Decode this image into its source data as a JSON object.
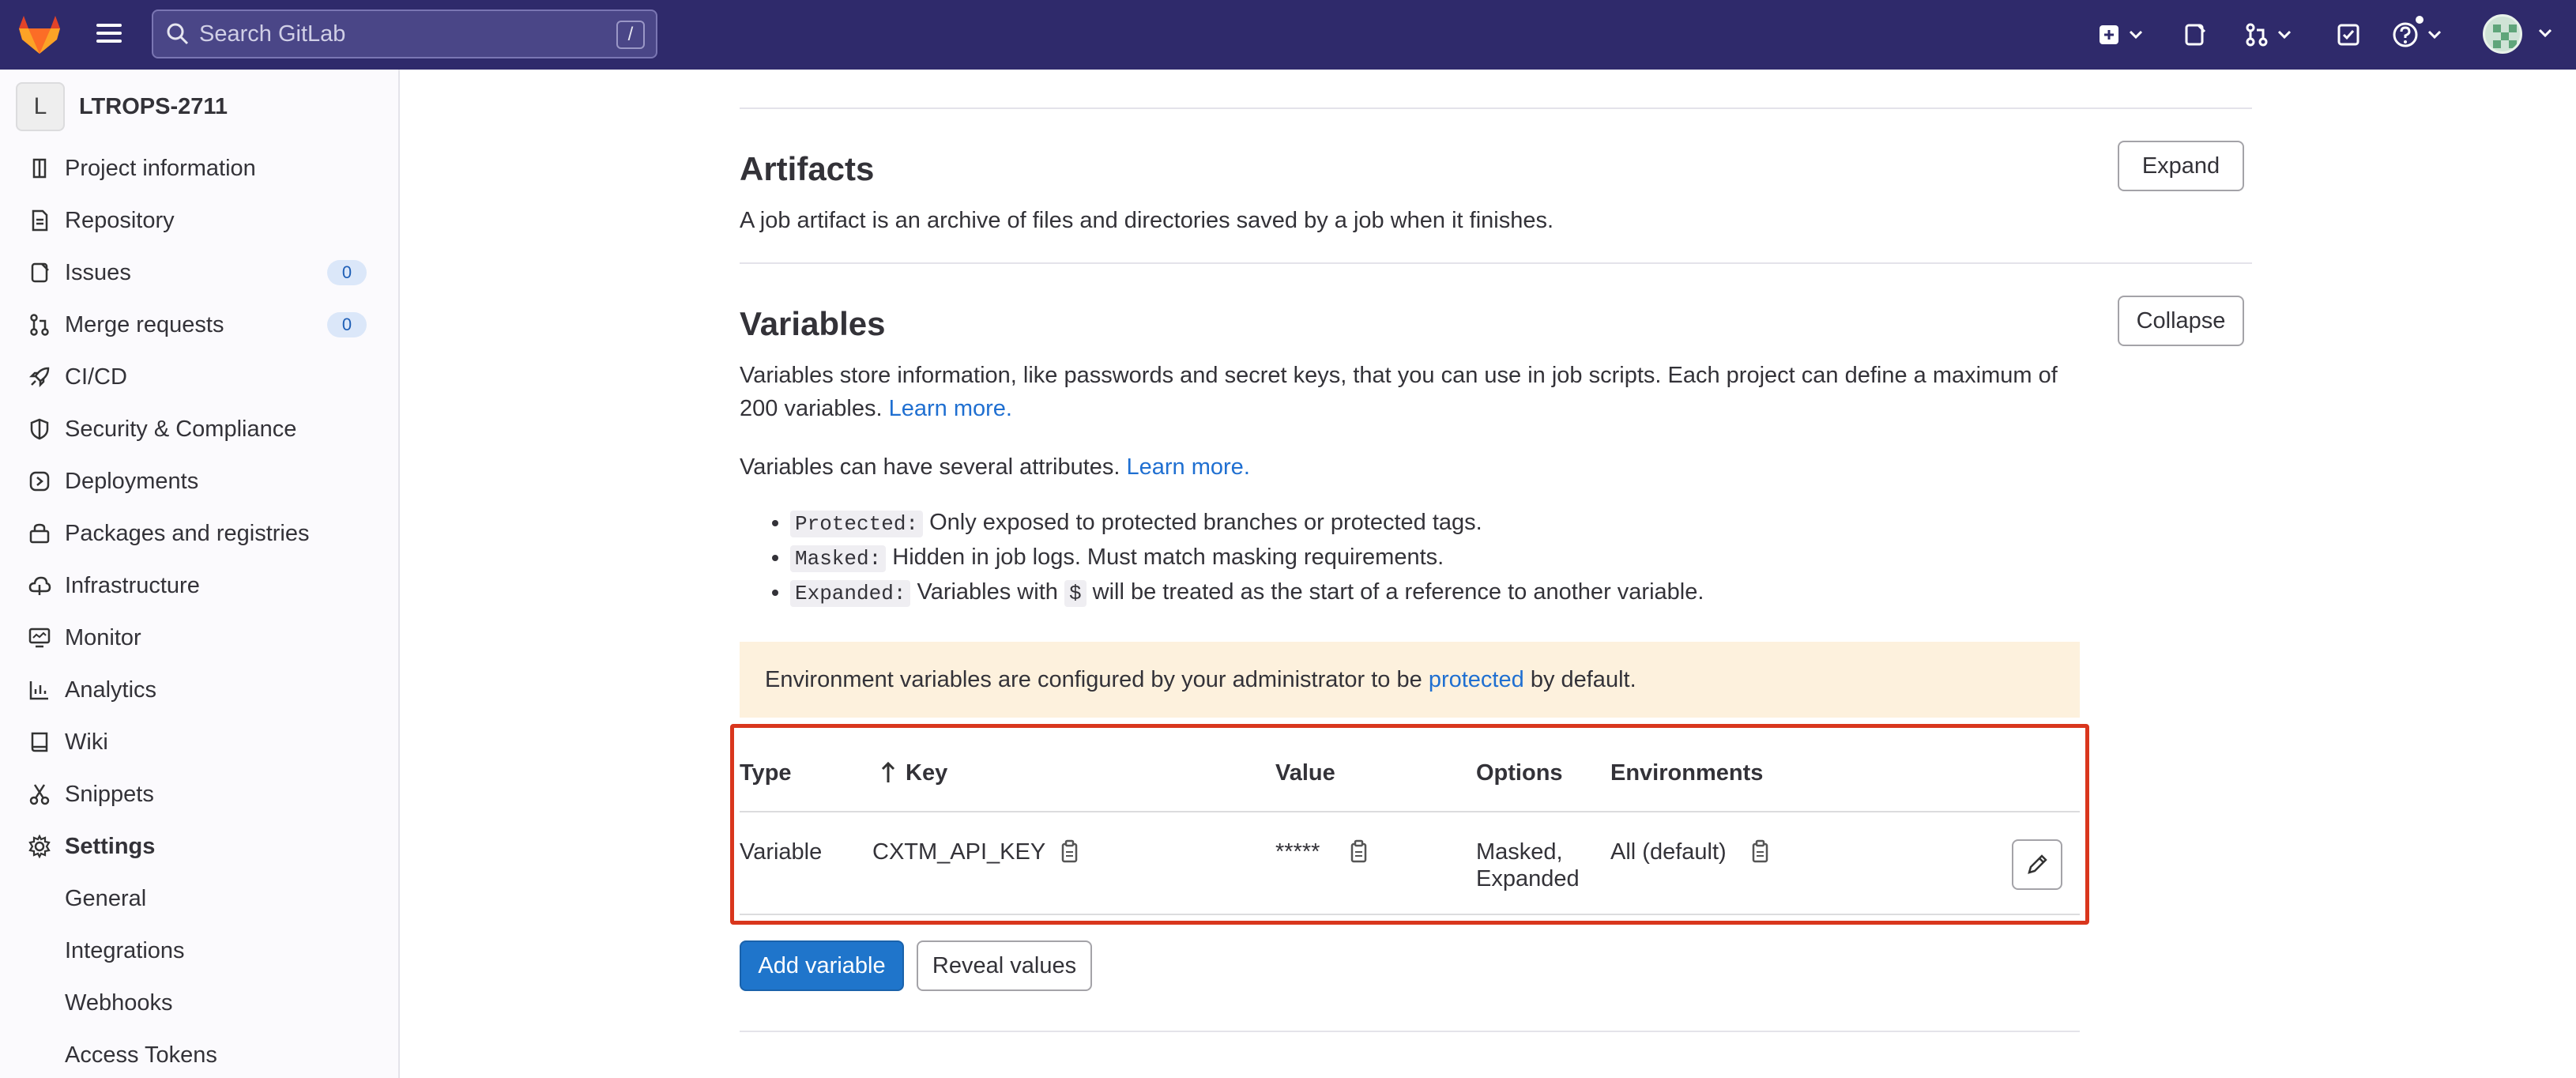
{
  "topbar": {
    "search_placeholder": "Search GitLab",
    "search_shortcut": "/"
  },
  "sidebar": {
    "project_initial": "L",
    "project_name": "LTROPS-2711",
    "items": [
      {
        "label": "Project information",
        "icon": "info-icon"
      },
      {
        "label": "Repository",
        "icon": "document-icon"
      },
      {
        "label": "Issues",
        "icon": "issues-icon",
        "badge": "0"
      },
      {
        "label": "Merge requests",
        "icon": "merge-request-icon",
        "badge": "0"
      },
      {
        "label": "CI/CD",
        "icon": "rocket-icon"
      },
      {
        "label": "Security & Compliance",
        "icon": "shield-icon"
      },
      {
        "label": "Deployments",
        "icon": "deployments-icon"
      },
      {
        "label": "Packages and registries",
        "icon": "package-icon"
      },
      {
        "label": "Infrastructure",
        "icon": "cloud-icon"
      },
      {
        "label": "Monitor",
        "icon": "monitor-icon"
      },
      {
        "label": "Analytics",
        "icon": "chart-icon"
      },
      {
        "label": "Wiki",
        "icon": "book-icon"
      },
      {
        "label": "Snippets",
        "icon": "scissors-icon"
      },
      {
        "label": "Settings",
        "icon": "gear-icon"
      }
    ],
    "settings_sub": [
      "General",
      "Integrations",
      "Webhooks",
      "Access Tokens"
    ]
  },
  "main": {
    "artifacts": {
      "title": "Artifacts",
      "description": "A job artifact is an archive of files and directories saved by a job when it finishes.",
      "button": "Expand"
    },
    "variables": {
      "title": "Variables",
      "button": "Collapse",
      "desc_line1": "Variables store information, like passwords and secret keys, that you can use in job scripts. Each project can define a maximum of",
      "desc_line2": "200 variables.",
      "learn_more": "Learn more.",
      "attrs_intro": "Variables can have several attributes.",
      "attrs": [
        {
          "code": "Protected:",
          "text": "Only exposed to protected branches or protected tags."
        },
        {
          "code": "Masked:",
          "text": "Hidden in job logs. Must match masking requirements."
        },
        {
          "code": "Expanded:",
          "text_before": "Variables with",
          "inline_code": "$",
          "text_after": "will be treated as the start of a reference to another variable."
        }
      ],
      "alert_before": "Environment variables are configured by your administrator to be",
      "alert_link": "protected",
      "alert_after": "by default.",
      "table": {
        "headers": {
          "type": "Type",
          "key": "Key",
          "value": "Value",
          "options": "Options",
          "environments": "Environments"
        },
        "rows": [
          {
            "type": "Variable",
            "key": "CXTM_API_KEY",
            "value": "*****",
            "options_line1": "Masked,",
            "options_line2": "Expanded",
            "environment": "All (default)"
          }
        ]
      },
      "add_button": "Add variable",
      "reveal_button": "Reveal values"
    }
  },
  "colors": {
    "topbar": "#2f2a6b",
    "link": "#1f6fd1",
    "primary": "#1f75cb",
    "highlight": "#d9361d",
    "alert_bg": "#fdf1dd"
  }
}
